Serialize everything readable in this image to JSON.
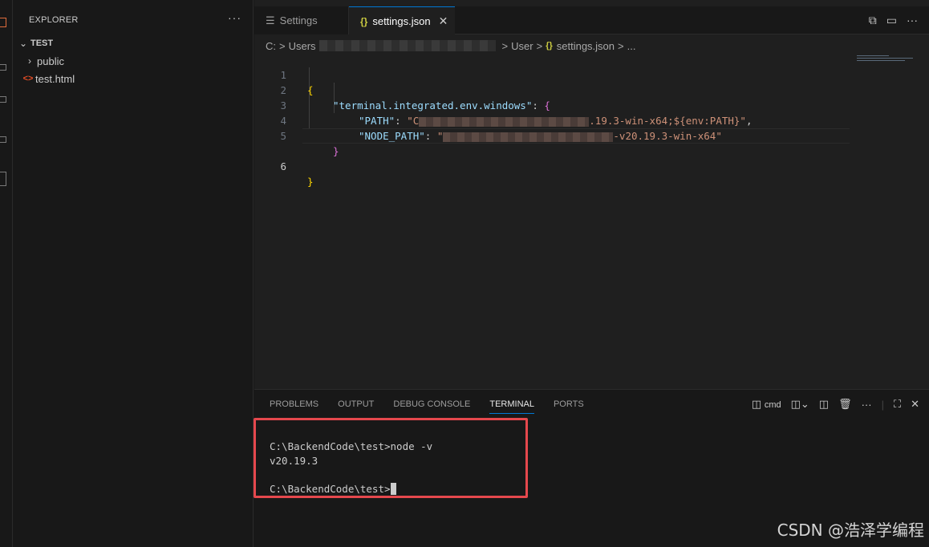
{
  "sidebar": {
    "title": "EXPLORER",
    "more": "···",
    "folder": "TEST",
    "items": [
      {
        "label": "public",
        "type": "folder"
      },
      {
        "label": "test.html",
        "type": "html-file"
      }
    ]
  },
  "tabs": [
    {
      "label": "Settings",
      "icon": "settings-icon",
      "active": false
    },
    {
      "label": "settings.json",
      "icon": "json-braces-icon",
      "active": true,
      "close": "✕"
    }
  ],
  "breadcrumb": {
    "parts": [
      "C:",
      "Users",
      "User",
      "settings.json",
      "..."
    ],
    "sep": ">",
    "file_icon": "{}"
  },
  "editor": {
    "line_numbers": [
      "1",
      "2",
      "3",
      "4",
      "5",
      "6"
    ],
    "current_line": "6",
    "lines": {
      "l1_open": "{",
      "l2_key": "\"terminal.integrated.env.windows\"",
      "l2_colon": ": ",
      "l2_open": "{",
      "l3_key": "\"PATH\"",
      "l3_colon": ": ",
      "l3_val_start": "\"C",
      "l3_val_end": ".19.3-win-x64;${env:PATH}\"",
      "l3_comma": ",",
      "l4_key": "\"NODE_PATH\"",
      "l4_colon": ": ",
      "l4_val_start": "\"",
      "l4_val_end": "-v20.19.3-win-x64\"",
      "l5_close": "}",
      "l6_close": "}"
    }
  },
  "panel": {
    "tabs": [
      "PROBLEMS",
      "OUTPUT",
      "DEBUG CONSOLE",
      "TERMINAL",
      "PORTS"
    ],
    "active_tab": "TERMINAL",
    "shell_label": "cmd",
    "terminal_lines": [
      "C:\\BackendCode\\test>node -v",
      "v20.19.3",
      "",
      "C:\\BackendCode\\test>"
    ]
  },
  "watermark": "CSDN @浩泽学编程",
  "colors": {
    "accent": "#0078d4",
    "highlight_box": "#e5484d",
    "json_key": "#9cdcfe",
    "json_string": "#ce9178"
  }
}
